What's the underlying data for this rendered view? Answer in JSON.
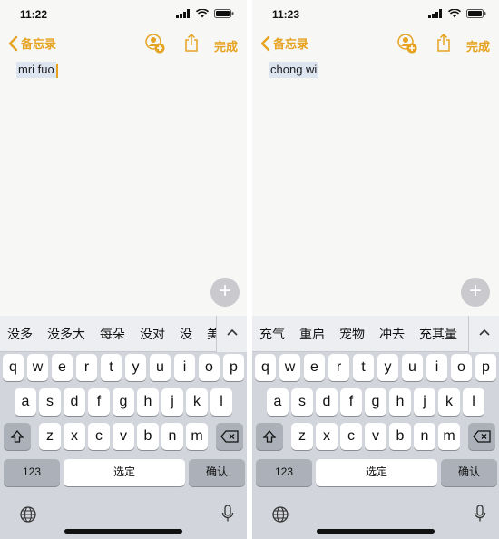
{
  "colors": {
    "accent": "#e6a321",
    "keyboard_bg": "#d2d5db",
    "note_bg": "#f7f7f5",
    "selection": "#dde6f0"
  },
  "screens": [
    {
      "status_time": "11:22",
      "back_label": "备忘录",
      "done_label": "完成",
      "note_text": "mri fuo",
      "candidates": [
        "没多",
        "没多大",
        "每朵",
        "没对",
        "没",
        "美"
      ],
      "keyboard": {
        "row1": [
          "q",
          "w",
          "e",
          "r",
          "t",
          "y",
          "u",
          "i",
          "o",
          "p"
        ],
        "row2": [
          "a",
          "s",
          "d",
          "f",
          "g",
          "h",
          "j",
          "k",
          "l"
        ],
        "row3": [
          "z",
          "x",
          "c",
          "v",
          "b",
          "n",
          "m"
        ],
        "numbers_label": "123",
        "space_label": "选定",
        "return_label": "确认"
      }
    },
    {
      "status_time": "11:23",
      "back_label": "备忘录",
      "done_label": "完成",
      "note_text": "chong wi",
      "candidates": [
        "充气",
        "重启",
        "宠物",
        "冲去",
        "充其量"
      ],
      "keyboard": {
        "row1": [
          "q",
          "w",
          "e",
          "r",
          "t",
          "y",
          "u",
          "i",
          "o",
          "p"
        ],
        "row2": [
          "a",
          "s",
          "d",
          "f",
          "g",
          "h",
          "j",
          "k",
          "l"
        ],
        "row3": [
          "z",
          "x",
          "c",
          "v",
          "b",
          "n",
          "m"
        ],
        "numbers_label": "123",
        "space_label": "选定",
        "return_label": "确认"
      }
    }
  ],
  "icons": [
    "signal-icon",
    "wifi-icon",
    "battery-icon",
    "chevron-left-icon",
    "add-person-icon",
    "share-icon",
    "plus-icon",
    "chevron-up-icon",
    "shift-icon",
    "backspace-icon",
    "globe-icon",
    "microphone-icon"
  ]
}
